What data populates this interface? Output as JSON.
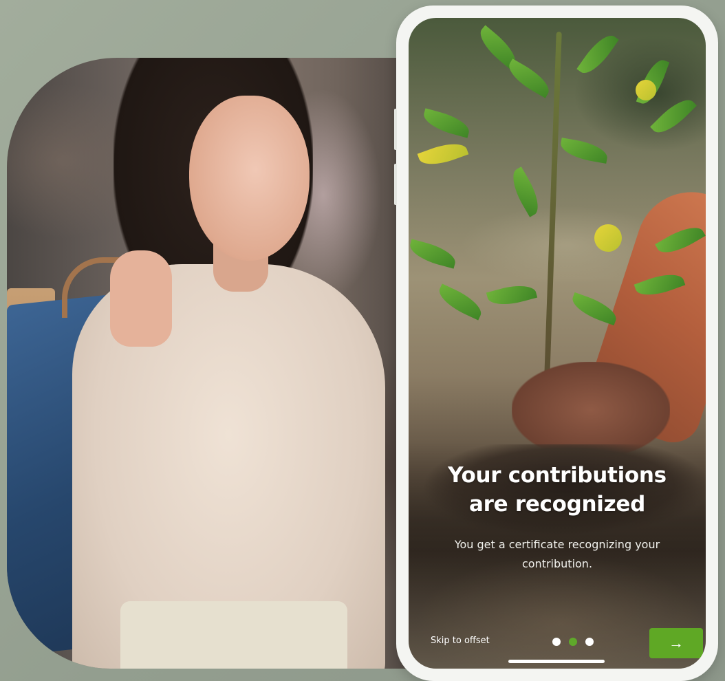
{
  "onboarding": {
    "headline_line1": "Your contributions",
    "headline_line2": "are recognized",
    "subtitle_line1": "You get a certificate recognizing your",
    "subtitle_line2": "contribution.",
    "skip_label": "Skip to offset",
    "next_icon": "→",
    "pagination": {
      "total": 3,
      "active_index": 1
    }
  },
  "colors": {
    "accent": "#5fa825",
    "background": "#9aa596",
    "phone_frame": "#f4f5f2"
  },
  "icons": {
    "next": "arrow-right-icon"
  }
}
